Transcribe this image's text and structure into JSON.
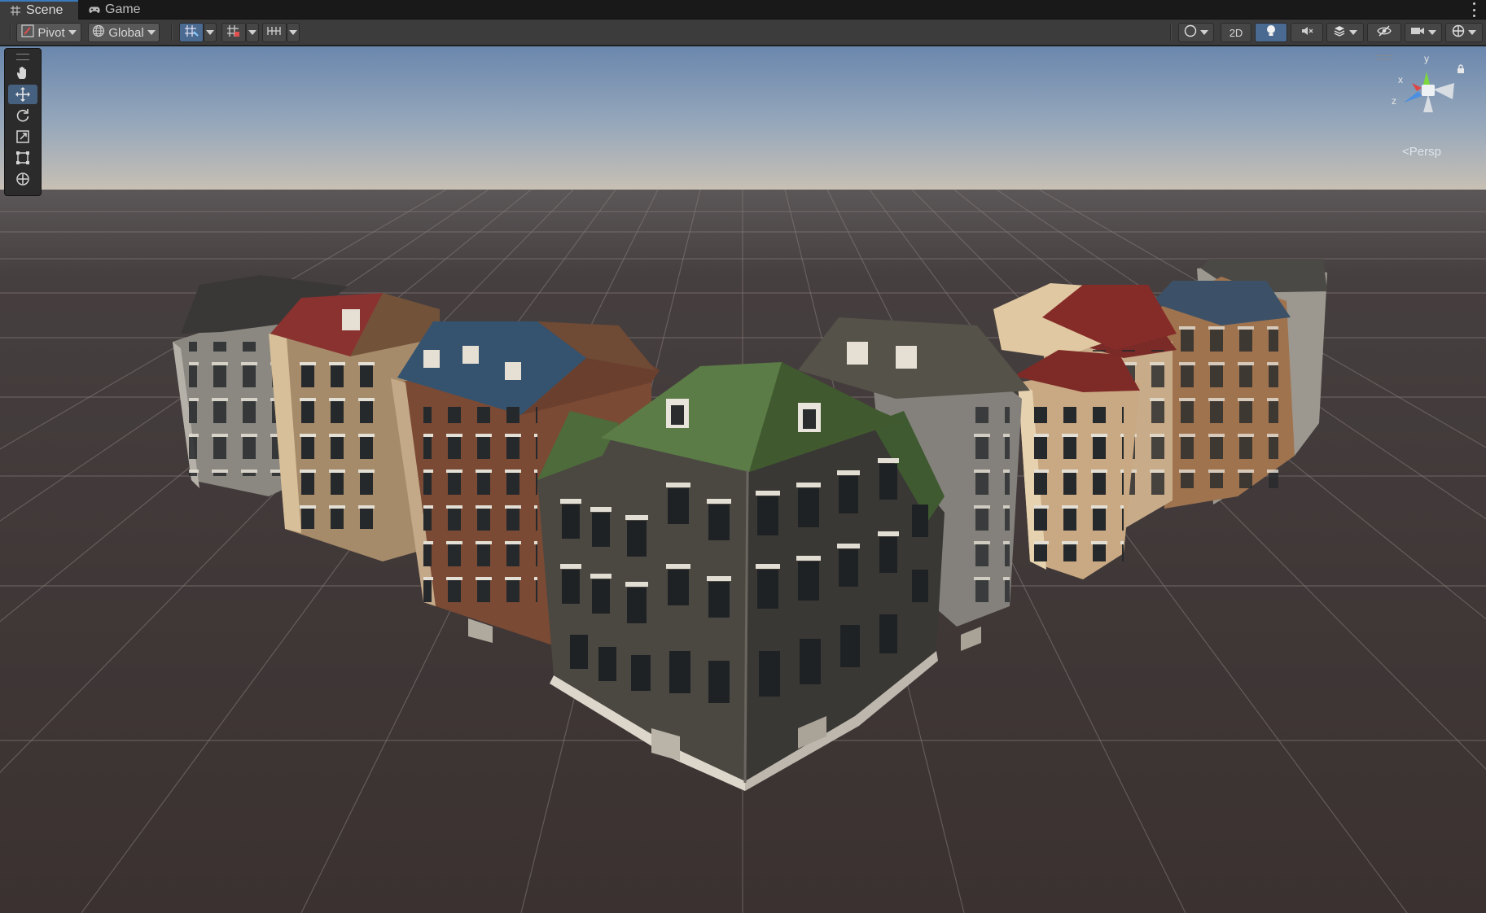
{
  "tabs": [
    {
      "label": "Scene",
      "icon": "grid-icon",
      "active": true
    },
    {
      "label": "Game",
      "icon": "gamepad-icon",
      "active": false
    }
  ],
  "toolbar": {
    "pivot_label": "Pivot",
    "global_label": "Global",
    "mode_2d_label": "2D"
  },
  "tools": [
    {
      "name": "hand-tool",
      "icon": "hand-icon",
      "active": false
    },
    {
      "name": "move-tool",
      "icon": "move-icon",
      "active": true
    },
    {
      "name": "rotate-tool",
      "icon": "rotate-icon",
      "active": false
    },
    {
      "name": "scale-tool",
      "icon": "scale-icon",
      "active": false
    },
    {
      "name": "rect-tool",
      "icon": "rect-icon",
      "active": false
    },
    {
      "name": "transform-tool",
      "icon": "transform-icon",
      "active": false
    }
  ],
  "gizmo": {
    "y_label": "y",
    "x_label": "x",
    "z_label": "z",
    "projection_label": "Persp"
  },
  "colors": {
    "accent": "#3a79bb",
    "active_tool": "#46607f",
    "sky_top": "#6d8aaf",
    "sky_horizon": "#c1bcb2",
    "ground": "#3b3433"
  }
}
